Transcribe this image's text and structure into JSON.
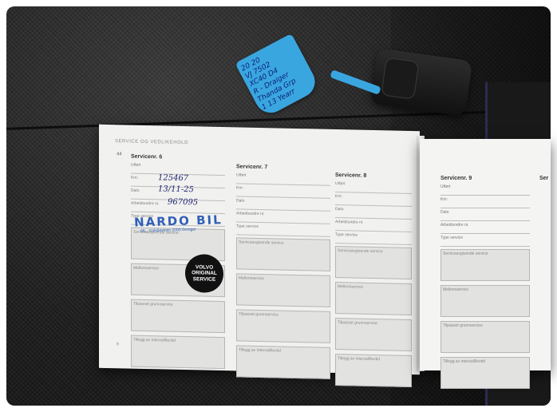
{
  "booklet": {
    "header": "SERVICE OG VEDLIKEHOLD",
    "page_marker": "44",
    "left_page_number": "8",
    "columns": [
      {
        "title": "Servicenr. 6",
        "fields": [
          "Utført",
          "Km:",
          "Dato",
          "Arbeidsordre nr.",
          "Type service"
        ],
        "boxes": [
          "Serviceavgivende service",
          "Mellomservice",
          "Tilpasset grunnservice",
          "Tillegg av intervall/levtid"
        ]
      },
      {
        "title": "Servicenr. 7",
        "fields": [
          "Utført",
          "Km:",
          "Dato",
          "Arbeidsordre nr.",
          "Type service"
        ],
        "boxes": [
          "Serviceavgivende service",
          "Mellomservice",
          "Tilpasset grunnservice",
          "Tillegg av intervall/levtid"
        ]
      },
      {
        "title": "Servicenr. 8",
        "fields": [
          "Utført",
          "Km:",
          "Dato",
          "Arbeidsordre nr.",
          "Type service"
        ],
        "boxes": [
          "Serviceavgivende service",
          "Mellomservice",
          "Tilpasset grunnservice",
          "Tillegg av intervall/levtid"
        ]
      },
      {
        "title": "Servicenr. 9",
        "fields": [
          "Utført",
          "Km:",
          "Dato",
          "Arbeidsordre nr.",
          "Type service"
        ],
        "boxes": [
          "Serviceavgivende service",
          "Mellomservice",
          "Tilpasset grunnservice",
          "Tillegg av intervall/levtid"
        ]
      }
    ],
    "partial_column_title": "Ser",
    "handwriting": {
      "km": "125467",
      "date": "13/11-25",
      "order": "967095"
    },
    "stamp": {
      "name": "NARDO BIL",
      "address": "08... Kolsåsveien 2000 Griniger"
    },
    "sticker": [
      "VOLVO",
      "ORIGINAL",
      "SERVICE"
    ]
  },
  "key_tag": {
    "lines": [
      "20   20",
      "VJ 7502",
      "XC40 D4",
      "R - Draiger",
      "Thanda Grp",
      "1 13  Yearr"
    ]
  }
}
